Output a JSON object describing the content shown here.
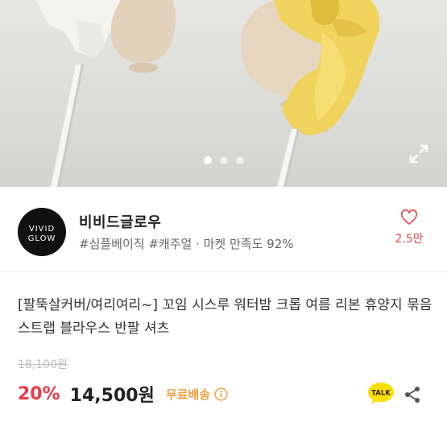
{
  "gallery": {
    "total_slides": 3,
    "active_slide": 1
  },
  "seller": {
    "name": "비비드글로우",
    "logo_text": [
      "VIVID",
      "GLOW"
    ],
    "meta": "#심플베이직 #캐주얼 · 마켓 만족도 92%",
    "likes": "2.5만"
  },
  "product": {
    "title": "[팔뚝살커버/여리여리~] 꼬임 시스루 워터밤 크롭 여름 리본 휴양지 묶음 스트랩 블라우스 반팔 셔츠",
    "original_price": "18,100원",
    "discount": "20%",
    "price": "14,500원",
    "shipping": "무료배송"
  },
  "actions": {
    "talk_label": "TALK"
  },
  "colors": {
    "accent_red": "#ee3a4a",
    "shipping_orange": "#f0a040",
    "talk_yellow": "#f9e000"
  },
  "icons": [
    "expand-icon",
    "heart-icon",
    "info-icon",
    "kakao-talk-icon",
    "share-icon"
  ]
}
